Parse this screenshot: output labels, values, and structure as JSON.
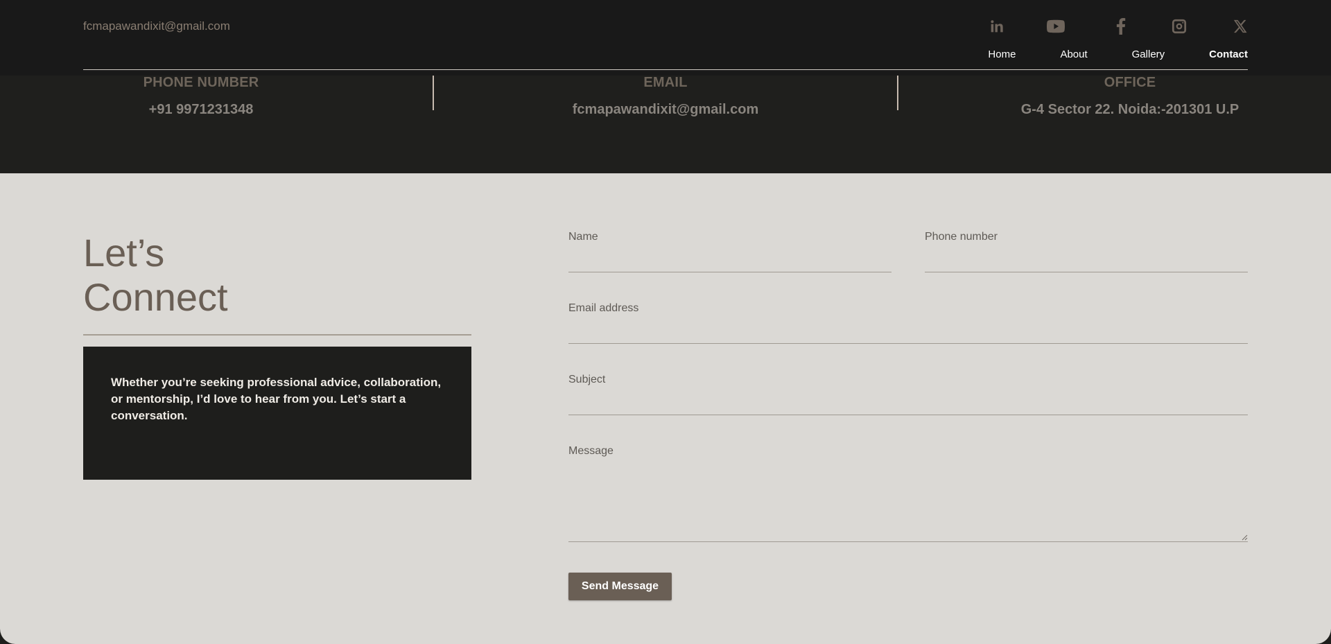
{
  "header": {
    "email": "fcmapawandixit@gmail.com",
    "socials": [
      "linkedin-icon",
      "youtube-icon",
      "facebook-icon",
      "instagram-icon",
      "x-twitter-icon"
    ],
    "nav": [
      {
        "label": "Home",
        "active": false
      },
      {
        "label": "About",
        "active": false
      },
      {
        "label": "Gallery",
        "active": false
      },
      {
        "label": "Contact",
        "active": true
      }
    ]
  },
  "info": {
    "phone": {
      "label": "PHONE NUMBER",
      "value": "+91 9971231348"
    },
    "email": {
      "label": "EMAIL",
      "value": "fcmapawandixit@gmail.com"
    },
    "office": {
      "label": "OFFICE",
      "value": "G-4 Sector 22. Noida:-201301 U.P"
    }
  },
  "connect": {
    "line1": "Let’s",
    "line2": "Connect",
    "message": "Whether you’re seeking professional advice, collaboration, or mentorship, I’d love to hear from you. Let’s start a conversation."
  },
  "form": {
    "name_label": "Name",
    "name_value": "",
    "phone_label": "Phone number",
    "phone_value": "",
    "email_label": "Email address",
    "email_value": "",
    "subject_label": "Subject",
    "subject_value": "",
    "message_label": "Message",
    "message_value": "",
    "submit_label": "Send Message"
  },
  "colors": {
    "accent": "#6a5f55",
    "dark": "#1f1f1d",
    "light": "#dbd9d5"
  }
}
